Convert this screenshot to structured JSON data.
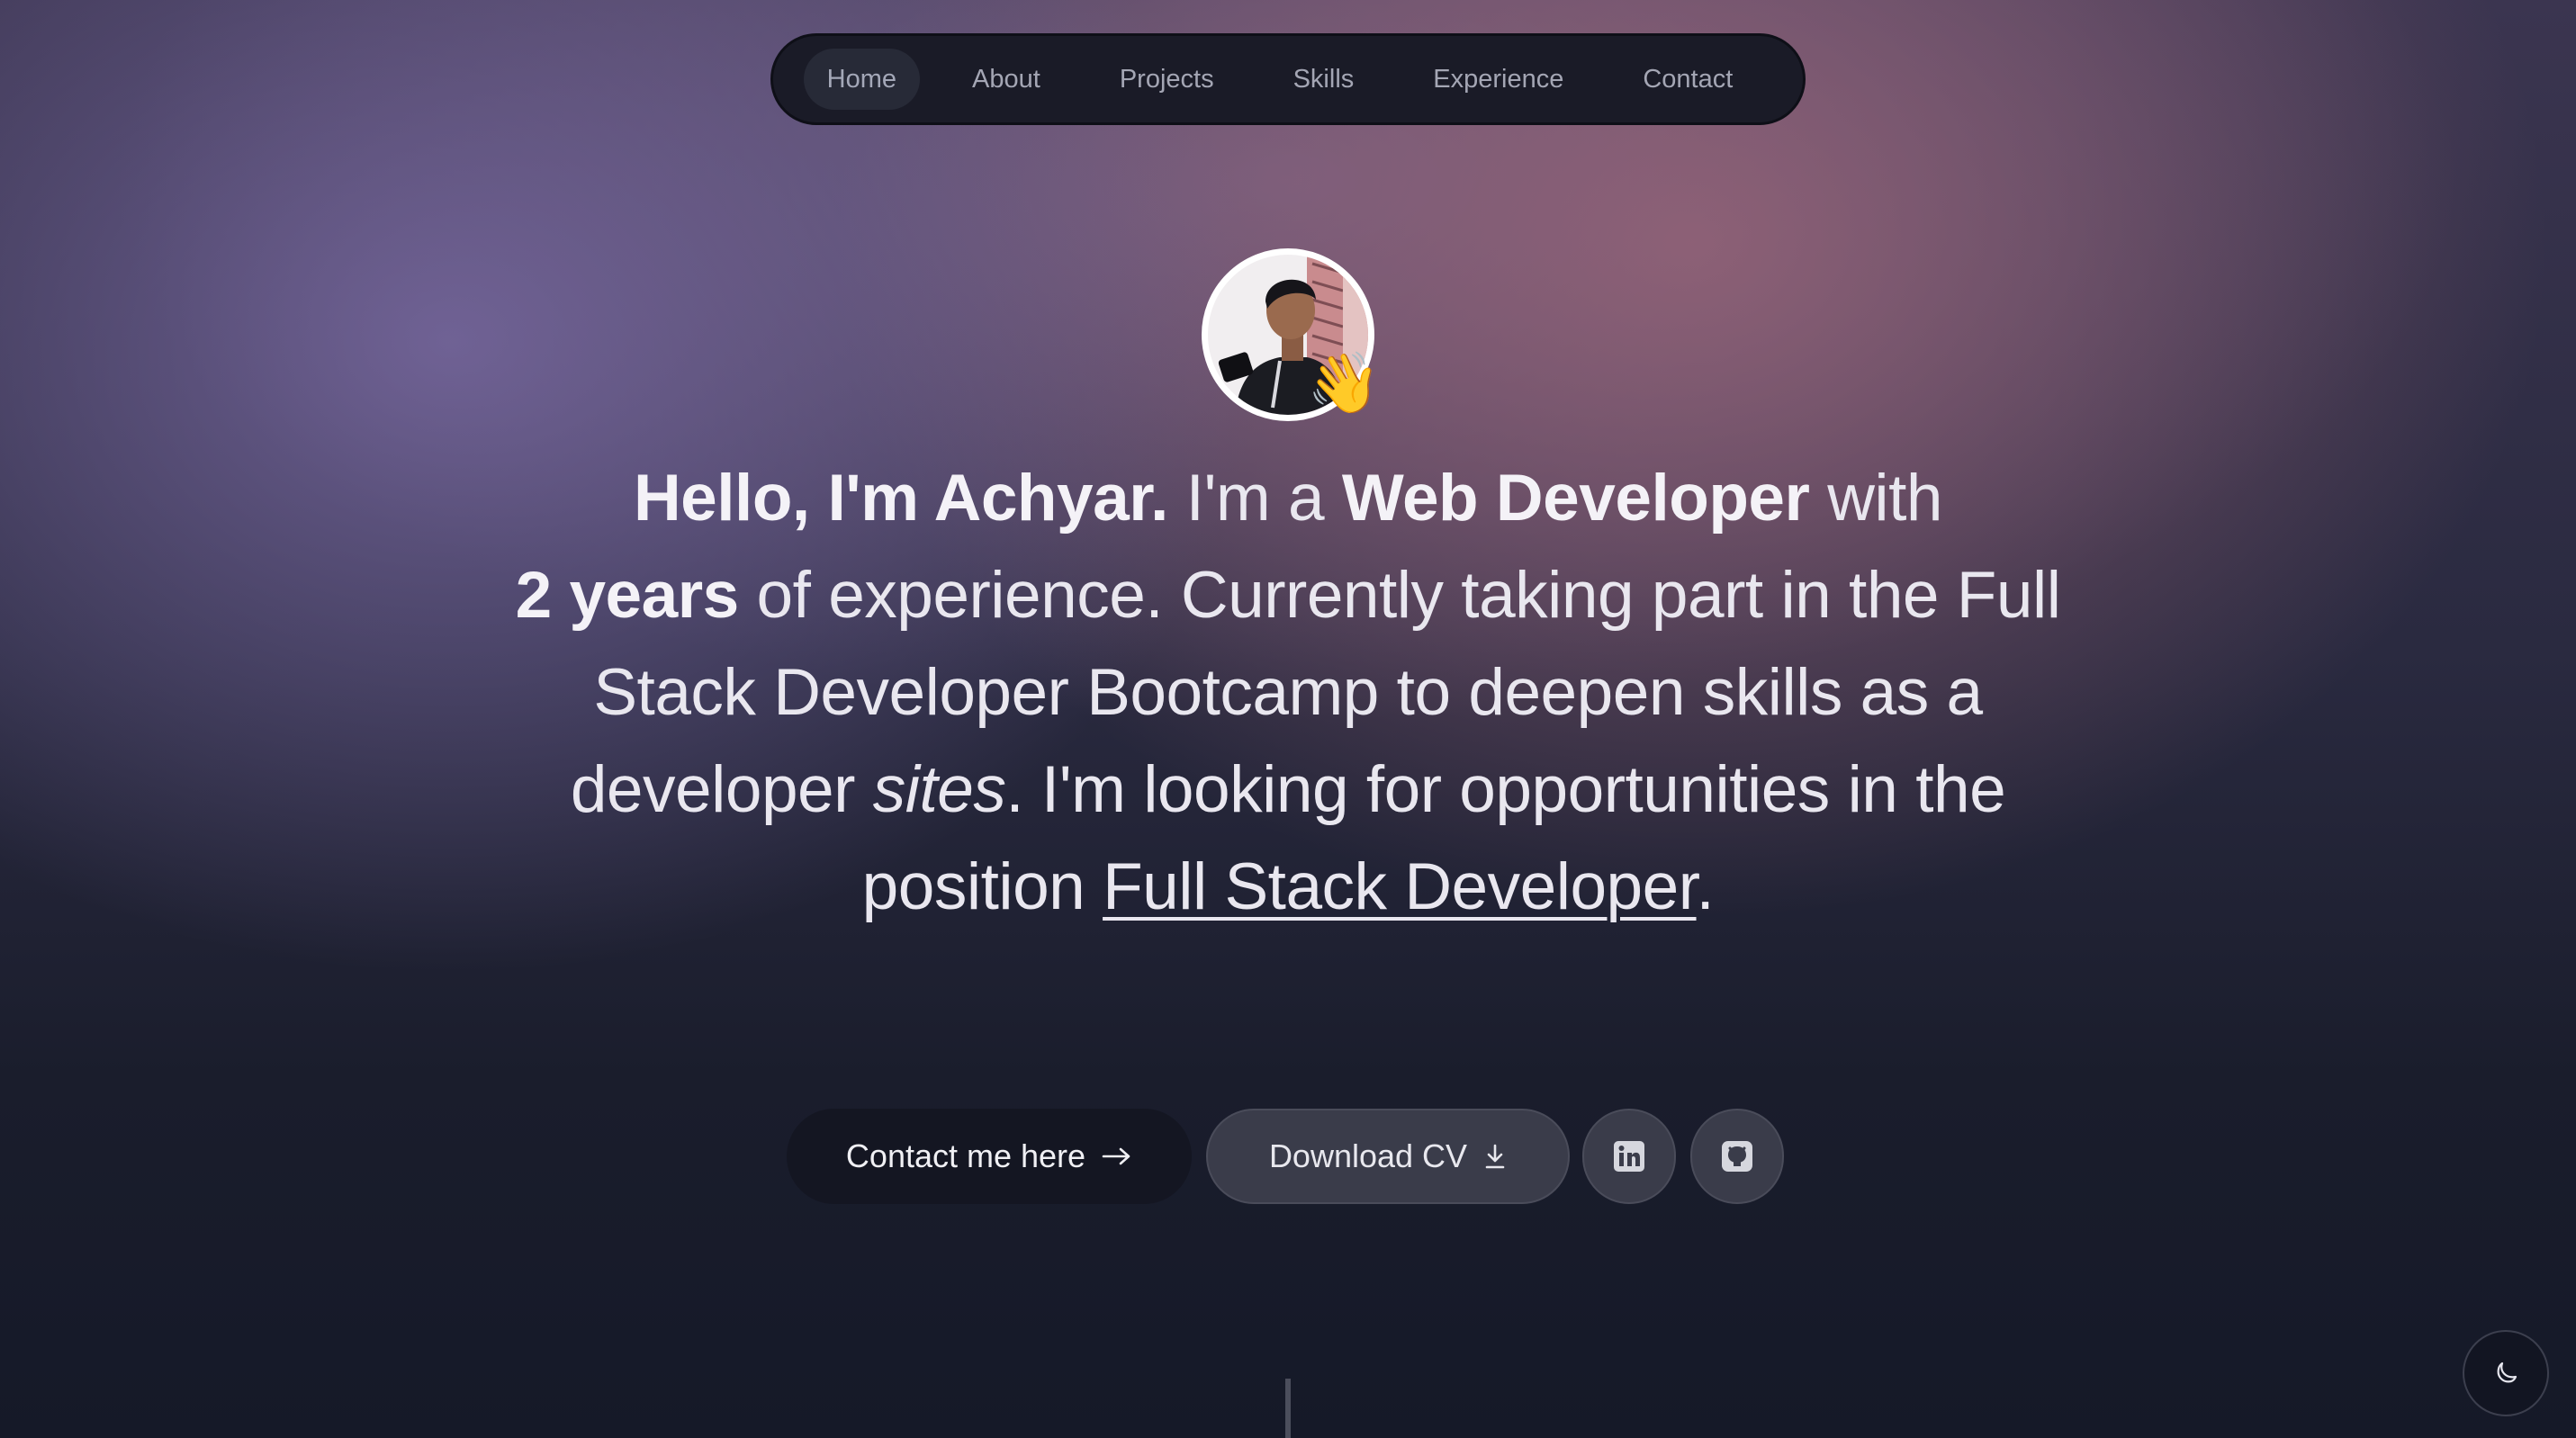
{
  "nav": {
    "items": [
      {
        "label": "Home",
        "active": true
      },
      {
        "label": "About"
      },
      {
        "label": "Projects"
      },
      {
        "label": "Skills"
      },
      {
        "label": "Experience"
      },
      {
        "label": "Contact"
      }
    ]
  },
  "hero": {
    "avatar_icon": "profile-photo",
    "wave_emoji": "👋",
    "greeting": "Hello, I'm Achyar.",
    "t1": " I'm a ",
    "role": "Web Developer",
    "t2": " with ",
    "years": "2 years",
    "t3": " of experience. Currently taking part in the Full Stack Developer Bootcamp to deepen skills as a developer ",
    "sites": "sites",
    "t4": ". I'm looking for opportunities in the position ",
    "position": "Full Stack Developer",
    "t5": "."
  },
  "actions": {
    "contact_label": "Contact me here",
    "contact_icon": "arrow-right-icon",
    "cv_label": "Download CV",
    "cv_icon": "download-icon",
    "linkedin_icon": "linkedin-icon",
    "github_icon": "github-icon"
  },
  "theme_toggle_icon": "moon-icon",
  "colors": {
    "nav_bg": "#1a1b27",
    "primary_button": "#141622",
    "secondary_button": "#3a3c4a",
    "text": "#e9e7ef"
  }
}
